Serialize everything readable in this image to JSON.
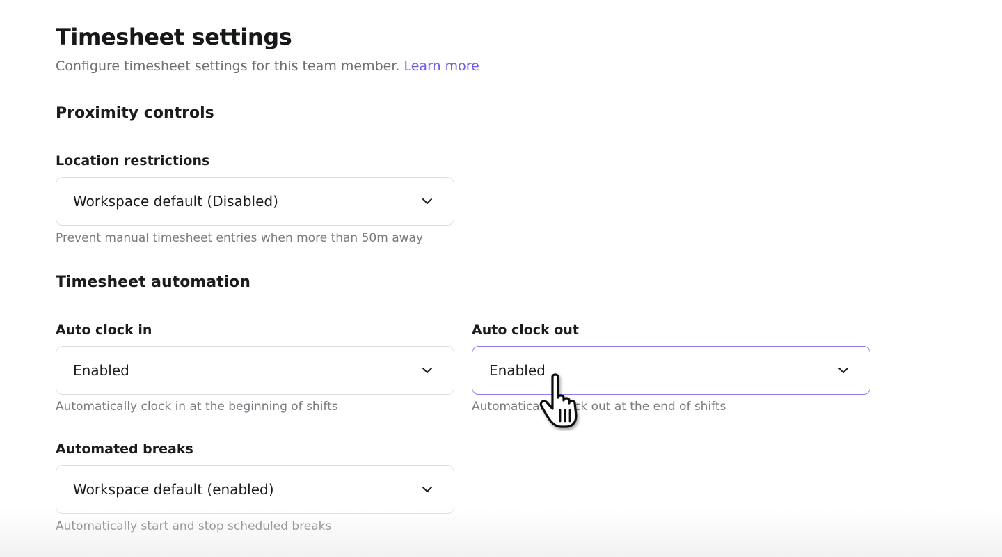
{
  "header": {
    "title": "Timesheet settings",
    "subtitle": "Configure timesheet settings for this team member.",
    "learn_more": "Learn more"
  },
  "proximity": {
    "heading": "Proximity controls",
    "location": {
      "label": "Location restrictions",
      "value": "Workspace default (Disabled)",
      "helper": "Prevent manual timesheet entries when more than 50m away"
    }
  },
  "automation": {
    "heading": "Timesheet automation",
    "clock_in": {
      "label": "Auto clock in",
      "value": "Enabled",
      "helper": "Automatically clock in at the beginning of shifts"
    },
    "clock_out": {
      "label": "Auto clock out",
      "value": "Enabled",
      "helper": "Automatically clock out at the end of shifts"
    },
    "breaks": {
      "label": "Automated breaks",
      "value": "Workspace default (enabled)",
      "helper": "Automatically start and stop scheduled breaks"
    }
  },
  "colors": {
    "accent": "#6c5ce7",
    "focus_border": "#8a7cf0",
    "muted_text": "#6e6e73"
  },
  "icons": {
    "select_chevron": "chevron-down-icon",
    "pointer": "hand-pointer-icon"
  }
}
